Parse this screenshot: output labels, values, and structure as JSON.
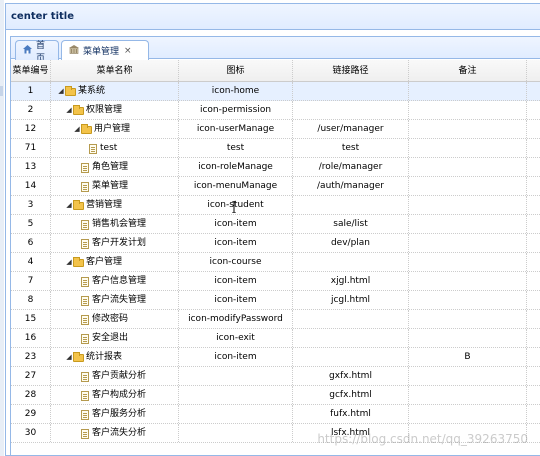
{
  "panel": {
    "title": "center title"
  },
  "tabs": [
    {
      "label": "首页",
      "icon": "home-icon"
    },
    {
      "label": "菜单管理",
      "icon": "building-icon",
      "close": "×"
    }
  ],
  "grid": {
    "headers": [
      "菜单编号",
      "菜单名称",
      "图标",
      "链接路径",
      "备注"
    ],
    "rows": [
      {
        "id": "1",
        "name": "某系统",
        "icon": "icon-home",
        "url": "",
        "note": "",
        "level": 0,
        "type": "folder"
      },
      {
        "id": "2",
        "name": "权限管理",
        "icon": "icon-permission",
        "url": "",
        "note": "",
        "level": 1,
        "type": "folder"
      },
      {
        "id": "12",
        "name": "用户管理",
        "icon": "icon-userManage",
        "url": "/user/manager",
        "note": "",
        "level": 2,
        "type": "folder"
      },
      {
        "id": "71",
        "name": "test",
        "icon": "test",
        "url": "test",
        "note": "",
        "level": 3,
        "type": "file"
      },
      {
        "id": "13",
        "name": "角色管理",
        "icon": "icon-roleManage",
        "url": "/role/manager",
        "note": "",
        "level": 2,
        "type": "file"
      },
      {
        "id": "14",
        "name": "菜单管理",
        "icon": "icon-menuManage",
        "url": "/auth/manager",
        "note": "",
        "level": 2,
        "type": "file"
      },
      {
        "id": "3",
        "name": "营销管理",
        "icon": "icon-student",
        "url": "",
        "note": "",
        "level": 1,
        "type": "folder"
      },
      {
        "id": "5",
        "name": "销售机会管理",
        "icon": "icon-item",
        "url": "sale/list",
        "note": "",
        "level": 2,
        "type": "file"
      },
      {
        "id": "6",
        "name": "客户开发计划",
        "icon": "icon-item",
        "url": "dev/plan",
        "note": "",
        "level": 2,
        "type": "file"
      },
      {
        "id": "4",
        "name": "客户管理",
        "icon": "icon-course",
        "url": "",
        "note": "",
        "level": 1,
        "type": "folder"
      },
      {
        "id": "7",
        "name": "客户信息管理",
        "icon": "icon-item",
        "url": "xjgl.html",
        "note": "",
        "level": 2,
        "type": "file"
      },
      {
        "id": "8",
        "name": "客户流失管理",
        "icon": "icon-item",
        "url": "jcgl.html",
        "note": "",
        "level": 2,
        "type": "file"
      },
      {
        "id": "15",
        "name": "修改密码",
        "icon": "icon-modifyPassword",
        "url": "",
        "note": "",
        "level": 2,
        "type": "file"
      },
      {
        "id": "16",
        "name": "安全退出",
        "icon": "icon-exit",
        "url": "",
        "note": "",
        "level": 2,
        "type": "file"
      },
      {
        "id": "23",
        "name": "统计报表",
        "icon": "icon-item",
        "url": "",
        "note": "B",
        "level": 1,
        "type": "folder"
      },
      {
        "id": "27",
        "name": "客户贡献分析",
        "icon": "",
        "url": "gxfx.html",
        "note": "",
        "level": 2,
        "type": "file"
      },
      {
        "id": "28",
        "name": "客户构成分析",
        "icon": "",
        "url": "gcfx.html",
        "note": "",
        "level": 2,
        "type": "file"
      },
      {
        "id": "29",
        "name": "客户服务分析",
        "icon": "",
        "url": "fufx.html",
        "note": "",
        "level": 2,
        "type": "file"
      },
      {
        "id": "30",
        "name": "客户流失分析",
        "icon": "",
        "url": "lsfx.html",
        "note": "",
        "level": 2,
        "type": "file"
      }
    ],
    "selected_row": 0
  },
  "watermark": "https://blog.csdn.net/qq_39263750",
  "colors": {
    "border": "#95b8e7",
    "header_bg": "#e0ecff",
    "selected_row": "#e6f0ff",
    "title": "#0e2d5f"
  }
}
